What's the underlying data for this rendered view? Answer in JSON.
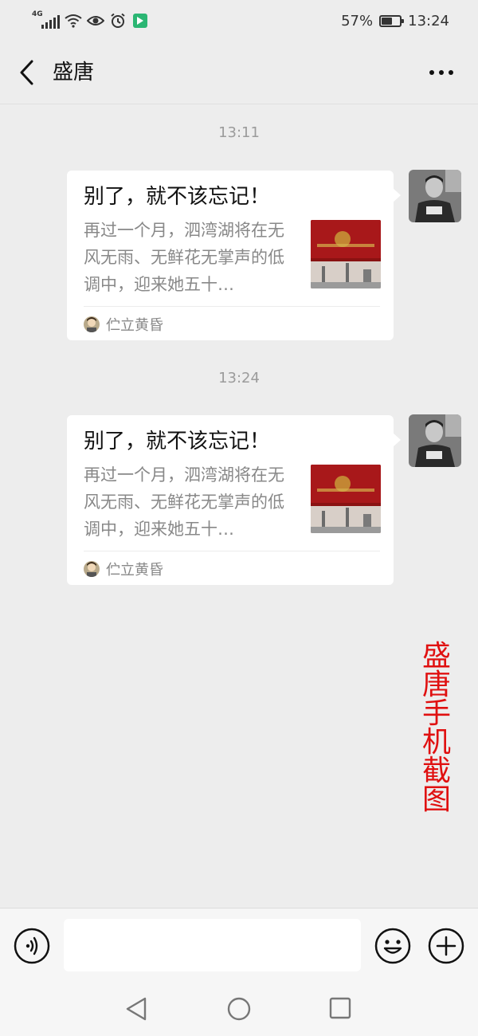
{
  "status_bar": {
    "network_label": "4G",
    "battery_percent_text": "57%",
    "battery_level": 0.57,
    "time": "13:24",
    "icons": [
      "signal-icon",
      "wifi-icon",
      "eye-icon",
      "alarm-icon",
      "app-notification-icon",
      "battery-icon"
    ]
  },
  "header": {
    "title": "盛唐",
    "back_icon": "chevron-left-icon",
    "more_icon": "more-dots-icon"
  },
  "messages": [
    {
      "timestamp": "13:11",
      "title": "别了，就不该忘记！",
      "description": "再过一个月，泗湾湖将在无风无雨、无鲜花无掌声的低调中，迎来她五十…",
      "source": "伫立黄昏"
    },
    {
      "timestamp": "13:24",
      "title": "别了，就不该忘记！",
      "description": "再过一个月，泗湾湖将在无风无雨、无鲜花无掌声的低调中，迎来她五十…",
      "source": "伫立黄昏"
    }
  ],
  "watermark": "盛唐手机截图",
  "input_bar": {
    "placeholder": "",
    "icons": [
      "voice-icon",
      "emoji-icon",
      "plus-icon"
    ]
  },
  "nav_bar": {
    "icons": [
      "nav-back-icon",
      "nav-home-icon",
      "nav-recent-icon"
    ]
  },
  "colors": {
    "background": "#ededed",
    "card": "#ffffff",
    "watermark": "#e01010",
    "timestamp": "#9b9b9b"
  }
}
